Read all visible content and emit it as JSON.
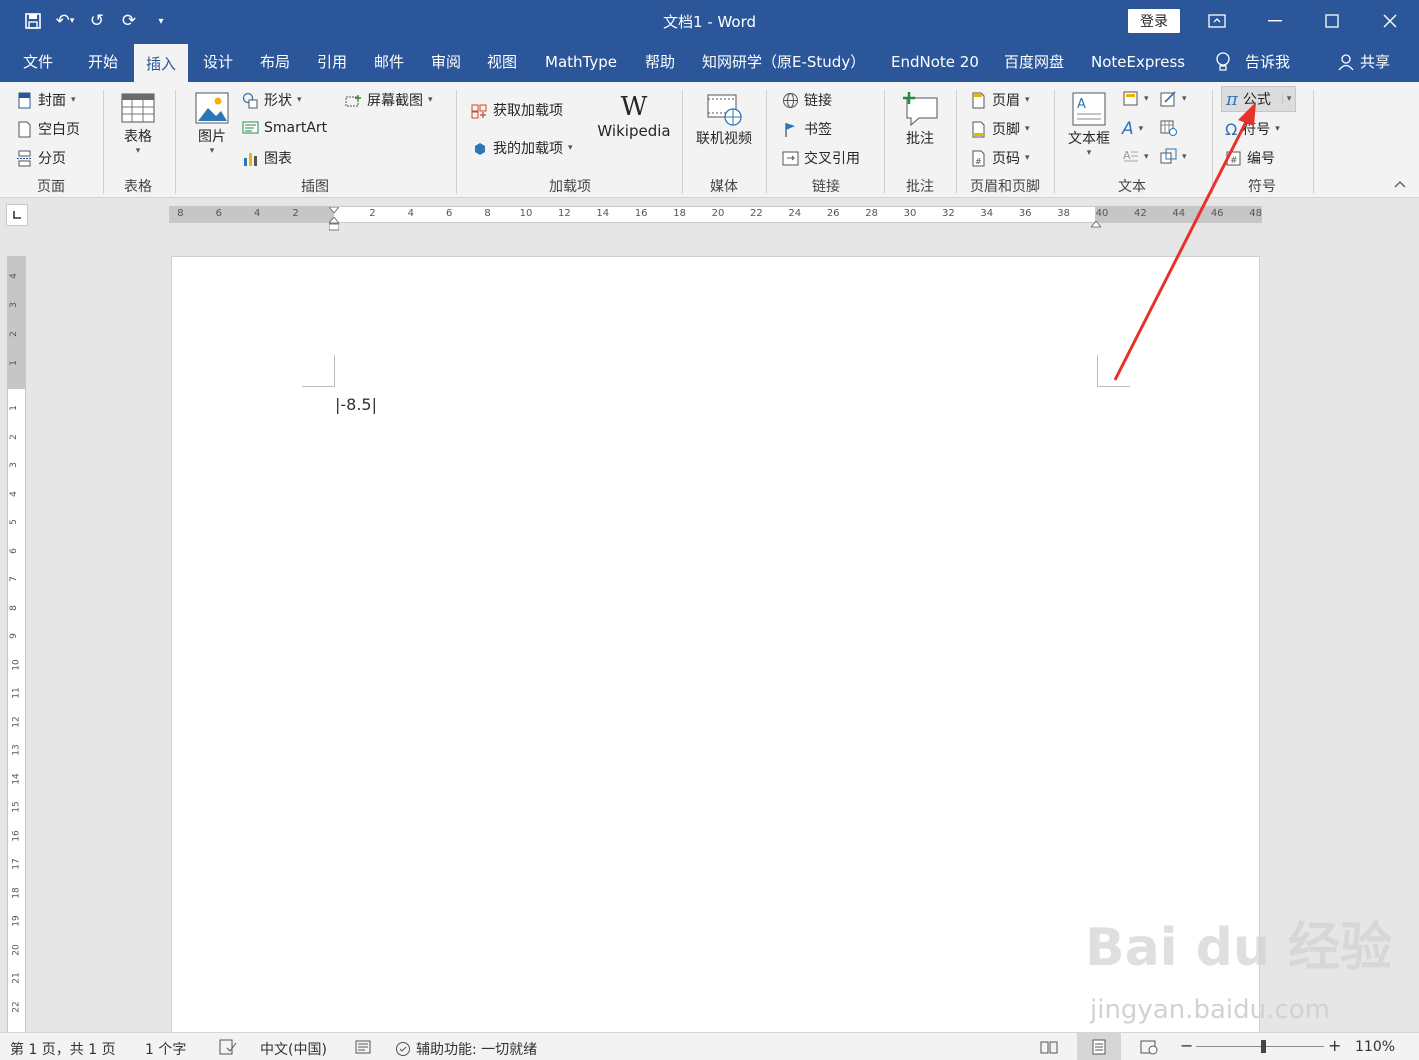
{
  "window": {
    "title": "文档1  -  Word",
    "login": "登录"
  },
  "tabs": [
    "文件",
    "开始",
    "插入",
    "设计",
    "布局",
    "引用",
    "邮件",
    "审阅",
    "视图",
    "MathType",
    "帮助",
    "知网研学（原E-Study）",
    "EndNote 20",
    "百度网盘",
    "NoteExpress",
    "告诉我",
    "共享"
  ],
  "active_tab": "插入",
  "ribbon": {
    "pages": {
      "cover": "封面",
      "blank": "空白页",
      "break": "分页",
      "group": "页面"
    },
    "table": {
      "label": "表格",
      "group": "表格"
    },
    "illustrations": {
      "picture": "图片",
      "shapes": "形状",
      "smartart": "SmartArt",
      "chart": "图表",
      "screenshot": "屏幕截图",
      "group": "插图"
    },
    "addins": {
      "get": "获取加载项",
      "my": "我的加载项",
      "wiki": "Wikipedia",
      "group": "加载项"
    },
    "media": {
      "video": "联机视频",
      "group": "媒体"
    },
    "links": {
      "link": "链接",
      "bookmark": "书签",
      "crossref": "交叉引用",
      "group": "链接"
    },
    "comments": {
      "comment": "批注",
      "group": "批注"
    },
    "headerfooter": {
      "header": "页眉",
      "footer": "页脚",
      "pagenum": "页码",
      "group": "页眉和页脚"
    },
    "text": {
      "textbox": "文本框",
      "group": "文本"
    },
    "symbols": {
      "equation": "公式",
      "symbol": "符号",
      "number": "编号",
      "group": "符号"
    }
  },
  "ruler": {
    "hlabels": [
      "8",
      "6",
      "4",
      "2",
      "2",
      "4",
      "6",
      "8",
      "10",
      "12",
      "14",
      "16",
      "18",
      "20",
      "22",
      "24",
      "26",
      "28",
      "30",
      "32",
      "34",
      "36",
      "38",
      "40",
      "42",
      "44",
      "46",
      "48"
    ]
  },
  "document": {
    "text": "|-8.5|"
  },
  "status": {
    "page": "第 1 页，共 1 页",
    "words": "1 个字",
    "lang": "中文(中国)",
    "access": "辅助功能: 一切就绪",
    "zoom": "110%"
  },
  "watermark": {
    "line1": "Bai du 经验",
    "line2": "jingyan.baidu.com"
  },
  "colors": {
    "brand": "#2b579a",
    "arrow": "#e8312b"
  }
}
